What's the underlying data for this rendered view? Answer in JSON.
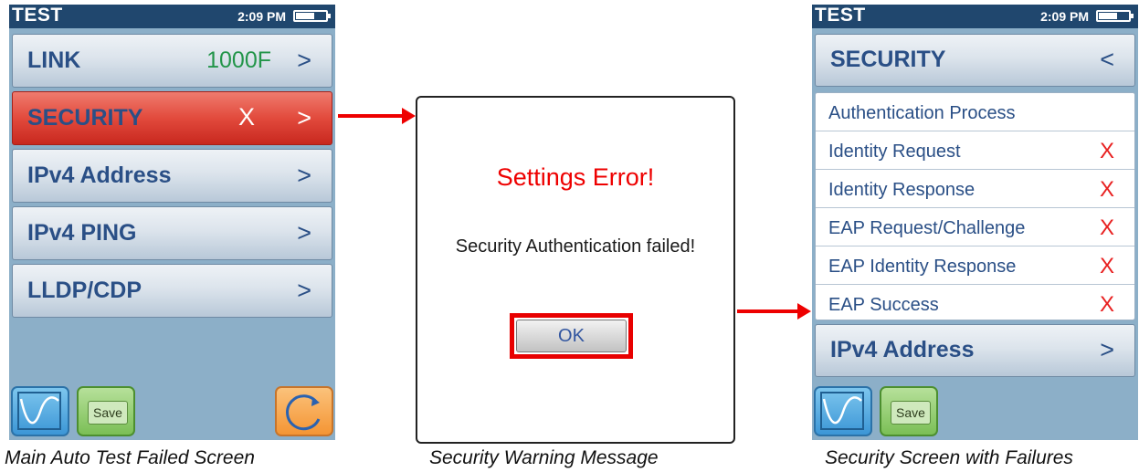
{
  "main_screen": {
    "status": {
      "title": "TEST",
      "time": "2:09 PM"
    },
    "rows": [
      {
        "label": "LINK",
        "value": "1000F",
        "chevron": ">"
      },
      {
        "label": "SECURITY",
        "status": "X",
        "chevron": ">"
      },
      {
        "label": "IPv4 Address",
        "chevron": ">"
      },
      {
        "label": "IPv4 PING",
        "chevron": ">"
      },
      {
        "label": "LLDP/CDP",
        "chevron": ">"
      }
    ],
    "save_label": "Save",
    "caption": "Main Auto Test Failed Screen"
  },
  "dialog": {
    "title": "Settings Error!",
    "message": "Security Authentication failed!",
    "ok_label": "OK",
    "caption": "Security Warning Message"
  },
  "security_screen": {
    "status": {
      "title": "TEST",
      "time": "2:09 PM"
    },
    "header": {
      "label": "SECURITY",
      "chevron": "<"
    },
    "items": [
      {
        "label": "Authentication Process",
        "status": ""
      },
      {
        "label": "Identity Request",
        "status": "X"
      },
      {
        "label": "Identity Response",
        "status": "X"
      },
      {
        "label": "EAP Request/Challenge",
        "status": "X"
      },
      {
        "label": "EAP Identity Response",
        "status": "X"
      },
      {
        "label": "EAP Success",
        "status": "X"
      }
    ],
    "next": {
      "label": "IPv4 Address",
      "chevron": ">"
    },
    "save_label": "Save",
    "caption": "Security Screen with Failures"
  },
  "colors": {
    "fail_red": "#e24a3c",
    "pass_green": "#23954a",
    "label_blue": "#2a4f86",
    "status_bar": "#20476e"
  },
  "icons": [
    "graph-icon",
    "save-folder-icon",
    "refresh-icon",
    "battery-icon"
  ]
}
